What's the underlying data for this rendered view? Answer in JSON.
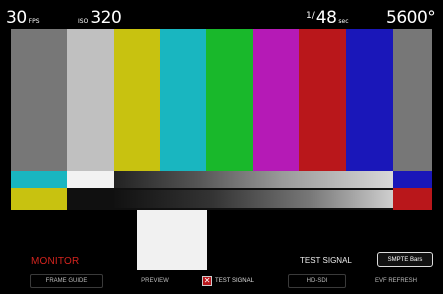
{
  "status": {
    "fps_value": "30",
    "fps_unit": "FPS",
    "iso_label": "ISO",
    "iso_value": "320",
    "shutter_sup": "1/",
    "shutter_value": "48",
    "shutter_unit": "sec",
    "white_balance": "5600°"
  },
  "monitor": {
    "label": "MONITOR",
    "test_signal_label": "TEST SIGNAL",
    "smpte_button": "SMPTE Bars"
  },
  "menu": {
    "frame_guide": "FRAME GUIDE",
    "preview": "PREVIEW",
    "test_signal": "TEST SIGNAL",
    "test_signal_checked": true,
    "hd_sdi": "HD-SDI",
    "evf_refresh": "EVF REFRESH"
  },
  "colors": {
    "accent_red": "#d3241e",
    "bars_top": [
      "#777777",
      "#c0c0c0",
      "#c8c210",
      "#19b6c0",
      "#19b82b",
      "#b51ab6",
      "#b9171b",
      "#1a17b9"
    ],
    "bars_mid": [
      "#19b6c0",
      "#f2f2f2",
      "#202020",
      "#c0c0c0",
      "#1a17b9"
    ]
  }
}
